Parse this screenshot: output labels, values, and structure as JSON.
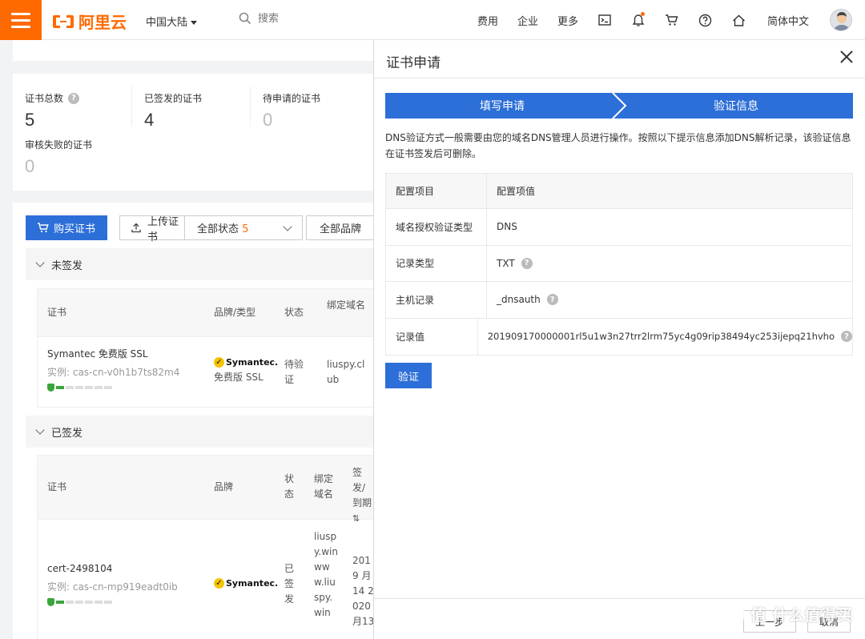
{
  "header": {
    "brand": "阿里云",
    "region": "中国大陆",
    "search_placeholder": "搜索",
    "nav": [
      "费用",
      "企业",
      "更多"
    ],
    "language": "简体中文"
  },
  "stats": {
    "total_label": "证书总数",
    "total_value": "5",
    "issued_label": "已签发的证书",
    "issued_value": "4",
    "pending_label": "待申请的证书",
    "pending_value": "0",
    "failed_label": "审核失败的证书",
    "failed_value": "0"
  },
  "toolbar": {
    "buy": "购买证书",
    "upload": "上传证书",
    "status_filter": "全部状态",
    "status_count": "5",
    "brand_filter": "全部品牌"
  },
  "groups": {
    "unsigned": "未签发",
    "signed": "已签发"
  },
  "table1": {
    "headers": [
      "证书",
      "品牌/类型",
      "状态",
      "绑定域名"
    ],
    "row": {
      "name": "Symantec 免费版 SSL",
      "instance": "实例: cas-cn-v0h1b7ts82m4",
      "brand": "Symantec.",
      "type": "免费版 SSL",
      "status": "待验证",
      "domain": "liuspy.club"
    }
  },
  "table2": {
    "headers": [
      "证书",
      "品牌",
      "状态",
      "绑定域名",
      "签发/到期"
    ],
    "row": {
      "name": "cert-2498104",
      "instance": "实例: cas-cn-mp919eadt0ib",
      "brand": "Symantec.",
      "status": "已签发",
      "domain": "liuspy.win www.liuspy.win",
      "dates": "2019 月14 2020 月13"
    }
  },
  "drawer": {
    "title": "证书申请",
    "step1": "填写申请",
    "step2": "验证信息",
    "description": "DNS验证方式一般需要由您的域名DNS管理人员进行操作。按照以下提示信息添加DNS解析记录，该验证信息在证书签发后可删除。",
    "table_headers": [
      "配置项目",
      "配置项值"
    ],
    "rows": [
      {
        "label": "域名授权验证类型",
        "value": "DNS"
      },
      {
        "label": "记录类型",
        "value": "TXT"
      },
      {
        "label": "主机记录",
        "value": "_dnsauth"
      },
      {
        "label": "记录值",
        "value": "201909170000001rl5u1w3n27trr2lrm75yc4g09rip38494yc253ijepq21hvho"
      }
    ],
    "verify": "验证",
    "prev": "上一步",
    "cancel": "取消"
  },
  "watermark": "值 什么值得买",
  "colors": {
    "accent": "#2d6fd8",
    "brand": "#ff6a00"
  }
}
